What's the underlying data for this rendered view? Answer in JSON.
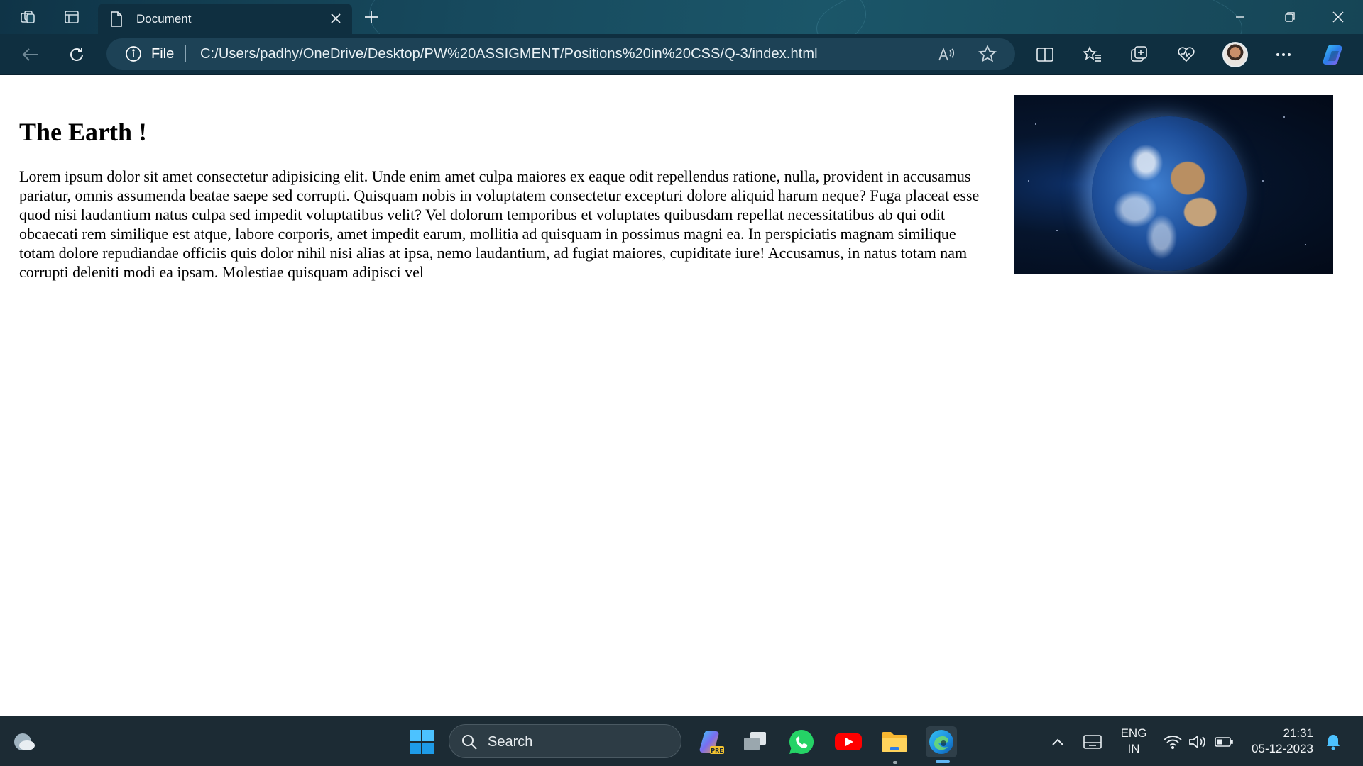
{
  "browser": {
    "tab_title": "Document",
    "address_scheme_label": "File",
    "url": "C:/Users/padhy/OneDrive/Desktop/PW%20ASSIGMENT/Positions%20in%20CSS/Q-3/index.html",
    "read_aloud_label": "Ȃ"
  },
  "page": {
    "heading": "The Earth !",
    "paragraph": "Lorem ipsum dolor sit amet consectetur adipisicing elit. Unde enim amet culpa maiores ex eaque odit repellendus ratione, nulla, provident in accusamus pariatur, omnis assumenda beatae saepe sed corrupti. Quisquam nobis in voluptatem consectetur excepturi dolore aliquid harum neque? Fuga placeat esse quod nisi laudantium natus culpa sed impedit voluptatibus velit? Vel dolorum temporibus et voluptates quibusdam repellat necessitatibus ab qui odit obcaecati rem similique est atque, labore corporis, amet impedit earum, mollitia ad quisquam in possimus magni ea. In perspiciatis magnam similique totam dolore repudiandae officiis quis dolor nihil nisi alias at ipsa, nemo laudantium, ad fugiat maiores, cupiditate iure! Accusamus, in natus totam nam corrupti deleniti modi ea ipsam. Molestiae quisquam adipisci vel",
    "image_subject": "earth-globe"
  },
  "taskbar": {
    "search_placeholder": "Search",
    "lang_line1": "ENG",
    "lang_line2": "IN",
    "time": "21:31",
    "date": "05-12-2023"
  },
  "colors": {
    "titlebar": "#174a5e",
    "toolbar": "#0f2f40",
    "addressbar": "#1d4256",
    "taskbar": "#1c2b34",
    "accent": "#5fb6f5"
  }
}
